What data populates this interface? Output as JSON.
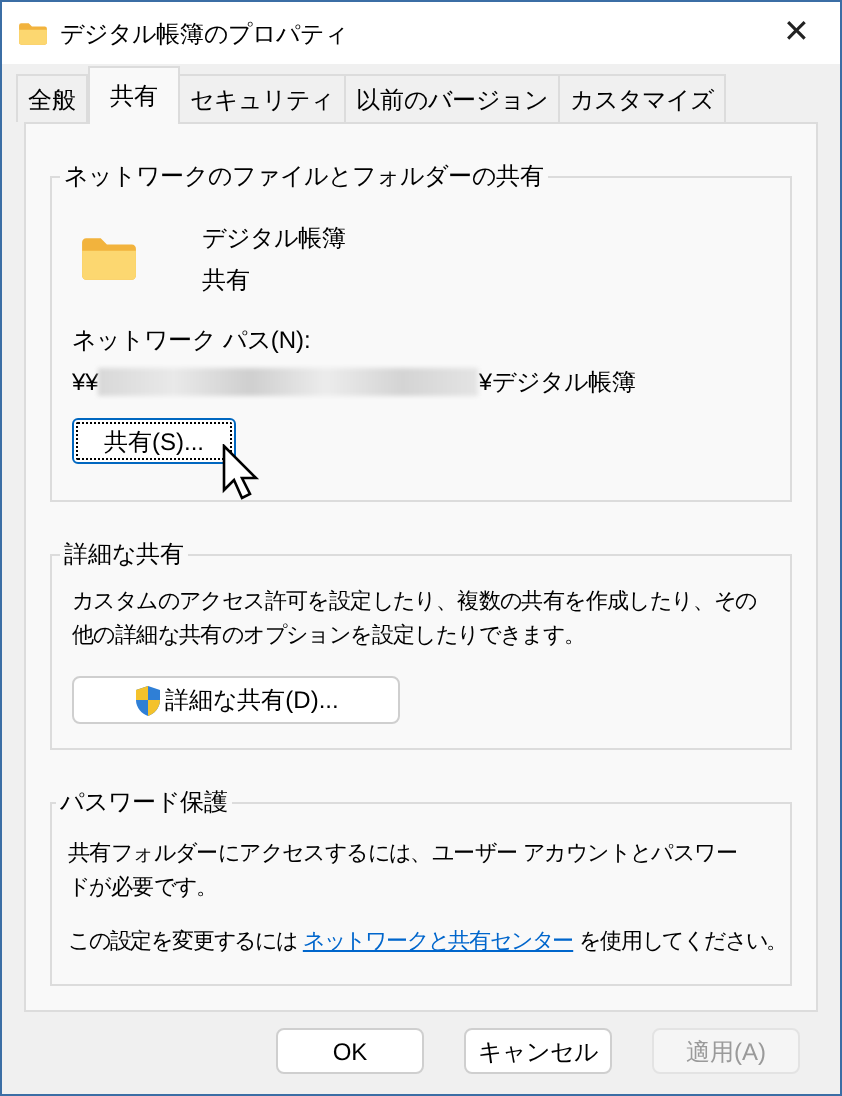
{
  "window": {
    "title": "デジタル帳簿のプロパティ",
    "close": "✕"
  },
  "tabs": [
    {
      "label": "全般",
      "selected": false
    },
    {
      "label": "共有",
      "selected": true
    },
    {
      "label": "セキュリティ",
      "selected": false
    },
    {
      "label": "以前のバージョン",
      "selected": false
    },
    {
      "label": "カスタマイズ",
      "selected": false
    }
  ],
  "network_sharing": {
    "title": "ネットワークのファイルとフォルダーの共有",
    "folder_name": "デジタル帳簿",
    "folder_status": "共有",
    "path_label": "ネットワーク パス(N):",
    "path_prefix": "¥¥",
    "path_redacted": true,
    "path_suffix": "¥デジタル帳簿",
    "share_button": {
      "label": "共有(S)...",
      "focused": true
    }
  },
  "advanced_sharing": {
    "title": "詳細な共有",
    "description": "カスタムのアクセス許可を設定したり、複数の共有を作成したり、その他の詳細な共有のオプションを設定したりできます。",
    "button": "詳細な共有(D)..."
  },
  "password_protection": {
    "title": "パスワード保護",
    "description": "共有フォルダーにアクセスするには、ユーザー アカウントとパスワードが必要です。",
    "link_before": "この設定を変更するには",
    "link": "ネットワークと共有センター",
    "link_after": "を使用してください。"
  },
  "buttons": [
    {
      "label": "OK",
      "disabled": false
    },
    {
      "label": "キャンセル",
      "disabled": false
    },
    {
      "label": "適用(A)",
      "disabled": true
    }
  ]
}
